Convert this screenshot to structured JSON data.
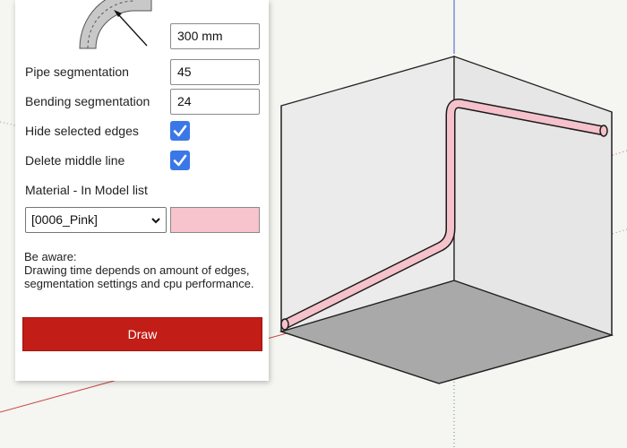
{
  "panel": {
    "radius_value": "300 mm",
    "pipe_segmentation": {
      "label": "Pipe segmentation",
      "value": "45"
    },
    "bending_segmentation": {
      "label": "Bending segmentation",
      "value": "24"
    },
    "hide_edges": {
      "label": "Hide selected edges",
      "checked": true
    },
    "delete_middle": {
      "label": "Delete middle line",
      "checked": true
    },
    "material": {
      "label": "Material - In Model list",
      "selected": "[0006_Pink]",
      "swatch_color": "#f7c3cc"
    },
    "note": {
      "title": "Be aware:",
      "line1": "Drawing time depends on amount of edges,",
      "line2": "segmentation settings and cpu performance."
    },
    "draw_label": "Draw",
    "draw_color": "#c21d17"
  },
  "viewport": {
    "background": "#f5f5f1",
    "pipe_color": "#f5c1cb",
    "floor_color": "#a9a9a9",
    "wall_color": "#e9e9e9"
  },
  "icons": [
    "bend-diagram-icon",
    "checkmark-icon",
    "chevron-down-icon"
  ]
}
